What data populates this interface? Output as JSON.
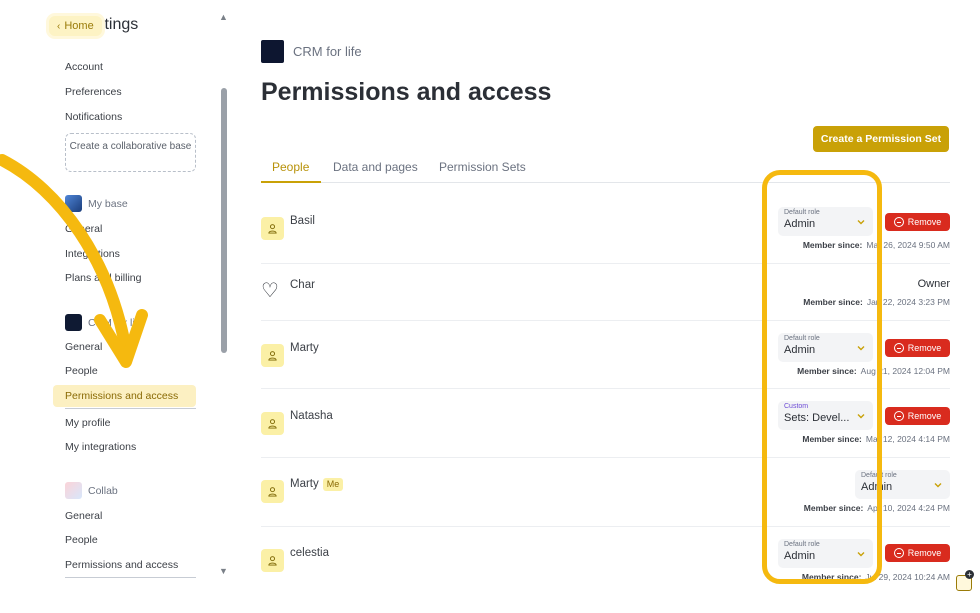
{
  "sidebar": {
    "home_label": "Home",
    "title": "ttings",
    "account_items": [
      "Account",
      "Preferences",
      "Notifications"
    ],
    "create_collab": "Create a collaborative base",
    "groups": [
      {
        "name": "My base",
        "items": [
          "General",
          "Integrations",
          "Plans and billing"
        ]
      },
      {
        "name": "CRM for life",
        "items": [
          "General",
          "People",
          "Permissions and access"
        ]
      },
      {
        "name": "Collab",
        "items": [
          "General",
          "People",
          "Permissions and access"
        ]
      }
    ],
    "personal_items": [
      "My profile",
      "My integrations"
    ]
  },
  "main": {
    "org_name": "CRM for life",
    "page_title": "Permissions and access",
    "create_button": "Create a Permission Set",
    "tabs": [
      "People",
      "Data and pages",
      "Permission Sets"
    ],
    "member_since_label": "Member since:",
    "remove_label": "Remove",
    "owner_label": "Owner",
    "people": [
      {
        "name": "Basil",
        "role_label": "Default role",
        "role": "Admin",
        "since": "Mar 26, 2024 9:50 AM"
      },
      {
        "name": "Char",
        "role": "Owner",
        "since": "Jan 22, 2024 3:23 PM"
      },
      {
        "name": "Marty",
        "role_label": "Default role",
        "role": "Admin",
        "since": "Aug 21, 2024 12:04 PM"
      },
      {
        "name": "Natasha",
        "role_label": "Custom",
        "role": "Sets: Devel...",
        "since": "Mar 12, 2024 4:14 PM"
      },
      {
        "name": "Marty",
        "badge": "Me",
        "role_label": "Default role",
        "role": "Admin",
        "since": "Apr 10, 2024 4:24 PM"
      },
      {
        "name": "celestia",
        "role_label": "Default role",
        "role": "Admin",
        "since": "Jul 29, 2024 10:24 AM"
      }
    ]
  },
  "colors": {
    "accent": "#c9a107",
    "remove": "#d92b1e",
    "highlight": "#f5b90f",
    "avatar": "#fbf0a6"
  }
}
